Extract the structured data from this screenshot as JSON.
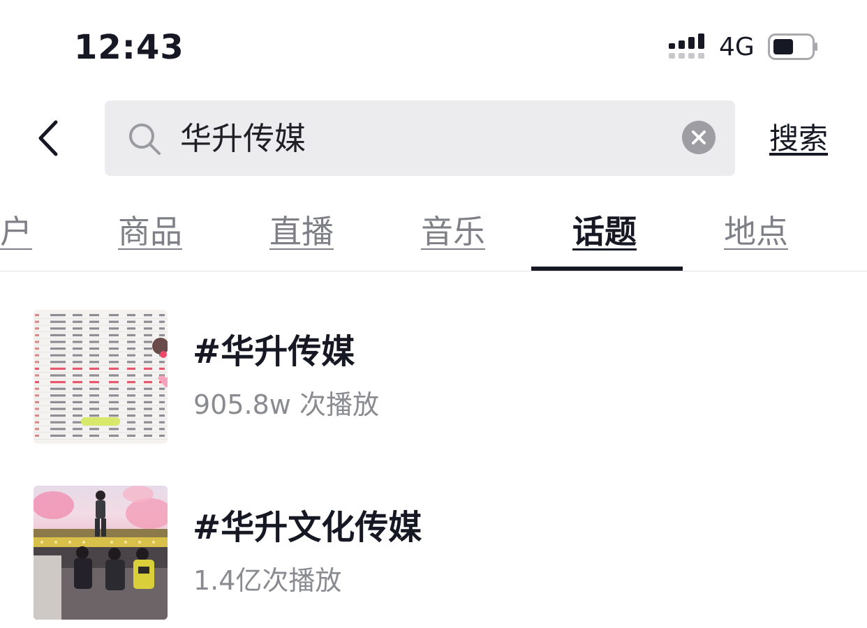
{
  "status_bar": {
    "time": "12:43",
    "network": "4G",
    "icons": [
      "signal-icon",
      "battery-icon"
    ]
  },
  "search": {
    "back_icon": "chevron-left-icon",
    "query": "华升传媒",
    "search_icon": "search-icon",
    "clear_icon": "close-icon",
    "submit_label": "搜索"
  },
  "tabs": [
    {
      "label": "户",
      "active": false
    },
    {
      "label": "商品",
      "active": false
    },
    {
      "label": "直播",
      "active": false
    },
    {
      "label": "音乐",
      "active": false
    },
    {
      "label": "话题",
      "active": true
    },
    {
      "label": "地点",
      "active": false
    }
  ],
  "results": [
    {
      "title": "#华升传媒",
      "plays": "905.8w 次播放",
      "thumbnail": "ranking-table-thumbnail"
    },
    {
      "title": "#华升文化传媒",
      "plays": "1.4亿次播放",
      "thumbnail": "stage-performance-thumbnail"
    }
  ],
  "colors": {
    "text": "#161823",
    "muted": "#7f8087",
    "search_bg": "#ececee",
    "accent_pink": "#f07aa0"
  }
}
